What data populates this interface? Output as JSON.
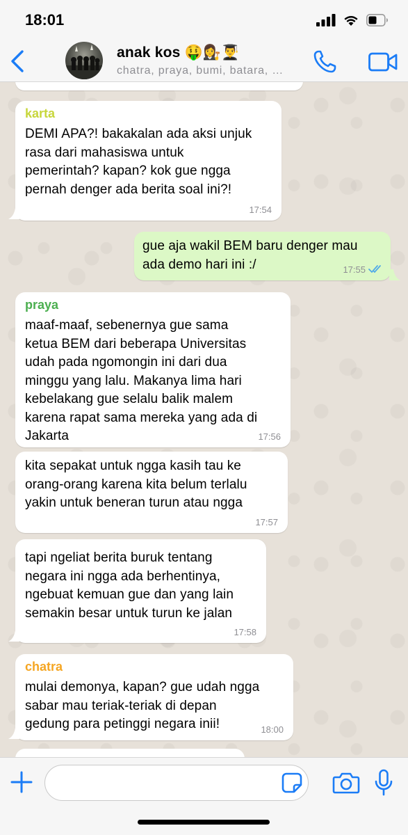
{
  "status_bar": {
    "time": "18:01",
    "icons": [
      "cellular-signal-icon",
      "wifi-icon",
      "battery-icon"
    ]
  },
  "header": {
    "back_icon": "chevron-left-icon",
    "title": "anak kos 🤑👩‍⚖️👨‍🎓",
    "subtitle": "chatra, praya, bumi, batara, …",
    "call_icon": "phone-icon",
    "video_icon": "video-camera-icon",
    "accent_color": "#1b7cf6"
  },
  "messages": [
    {
      "direction": "in",
      "sender": "karta",
      "sender_color": "#c7d63b",
      "lines": [
        "DEMI APA?! bakakalan ada aksi unjuk",
        "rasa dari mahasiswa untuk",
        "pemerintah? kapan? kok gue ngga",
        "pernah denger ada berita soal ini?!"
      ],
      "time": "17:54"
    },
    {
      "direction": "out",
      "lines": [
        "gue aja wakil BEM baru denger mau",
        "ada demo hari ini :/"
      ],
      "time": "17:55",
      "status_icon": "double-check-read-icon"
    },
    {
      "direction": "in",
      "sender": "praya",
      "sender_color": "#4caf50",
      "lines": [
        "maaf-maaf, sebenernya gue sama",
        "ketua BEM dari beberapa Universitas",
        "udah pada ngomongin ini dari dua",
        "minggu yang lalu. Makanya lima hari",
        "kebelakang gue selalu balik malem",
        "karena rapat sama mereka yang ada di",
        "Jakarta"
      ],
      "time": "17:56"
    },
    {
      "direction": "in",
      "lines": [
        "kita sepakat untuk ngga kasih tau ke",
        "orang-orang karena kita belum terlalu",
        "yakin untuk beneran turun atau ngga"
      ],
      "time": "17:57"
    },
    {
      "direction": "in",
      "lines": [
        "tapi ngeliat berita buruk tentang",
        "negara ini ngga ada berhentinya,",
        "ngebuat kemuan gue dan yang lain",
        "semakin besar untuk turun ke jalan"
      ],
      "time": "17:58"
    },
    {
      "direction": "in",
      "sender": "chatra",
      "sender_color": "#f5a623",
      "lines": [
        "mulai demonya, kapan? gue udah ngga",
        "sabar mau teriak-teriak di depan",
        "gedung para petinggi negara inii!"
      ],
      "time": "18:00"
    }
  ],
  "input_bar": {
    "plus_icon": "plus-icon",
    "message_value": "",
    "sticker_icon": "sticker-icon",
    "camera_icon": "camera-icon",
    "mic_icon": "microphone-icon"
  }
}
